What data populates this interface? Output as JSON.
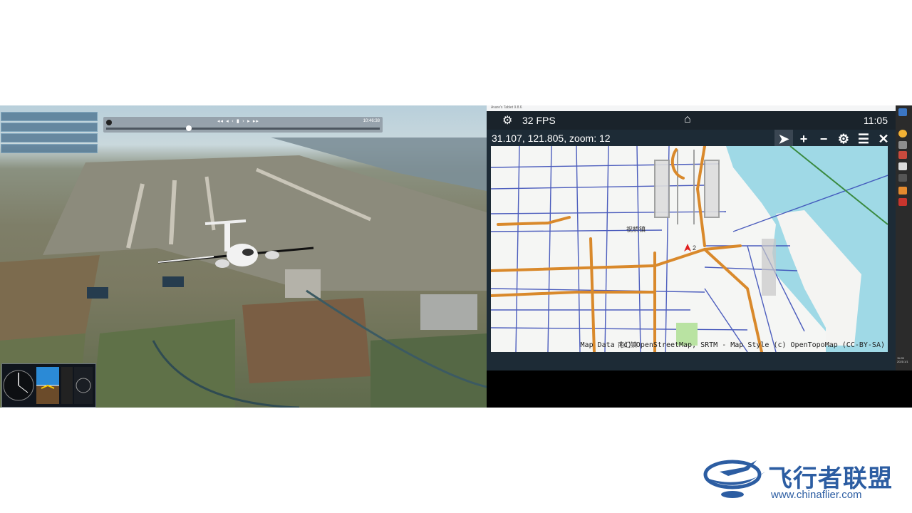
{
  "simulator": {
    "replay": {
      "controls_label": "◂◂ ◂ ‹ ▮ › ▸ ▸▸",
      "time": "10:46:38",
      "position_fraction": 0.3
    }
  },
  "avare": {
    "window_title": "Avare's Tablet 9.8.6",
    "top_bar": {
      "settings_icon": "gear-icon",
      "fps": "32 FPS",
      "home_icon": "home-icon",
      "clock": "11:05"
    },
    "coordinates_text": "31.107, 121.805, zoom: 12",
    "toolbar": [
      {
        "name": "locate-button",
        "icon": "navigation-arrow-icon",
        "glyph": "➤",
        "active": true
      },
      {
        "name": "zoom-in-button",
        "icon": "plus-icon",
        "glyph": "+",
        "active": false
      },
      {
        "name": "zoom-out-button",
        "icon": "minus-icon",
        "glyph": "−",
        "active": false
      },
      {
        "name": "map-settings-button",
        "icon": "gear-icon",
        "glyph": "⚙",
        "active": false
      },
      {
        "name": "layers-button",
        "icon": "list-icon",
        "glyph": "☰",
        "active": false
      },
      {
        "name": "close-button",
        "icon": "close-icon",
        "glyph": "✕",
        "active": false
      }
    ],
    "map": {
      "labels": [
        "祝桥镇",
        "南汇镇"
      ],
      "aircraft_marker_label": "2",
      "attribution": "Map Data (c) OpenStreetMap, SRTM - Map Style (c) OpenTopoMap (CC-BY-SA)",
      "colors": {
        "sea": "#9fd9e6",
        "roads_major": "#d9892b",
        "roads_minor": "#3a4db8"
      }
    },
    "taskbar_time": "11:05",
    "taskbar_date": "2021/1/1"
  },
  "watermark": {
    "chinese_text": "飞行者联盟",
    "url": "www.chinaflier.com",
    "color": "#2c5da2"
  }
}
